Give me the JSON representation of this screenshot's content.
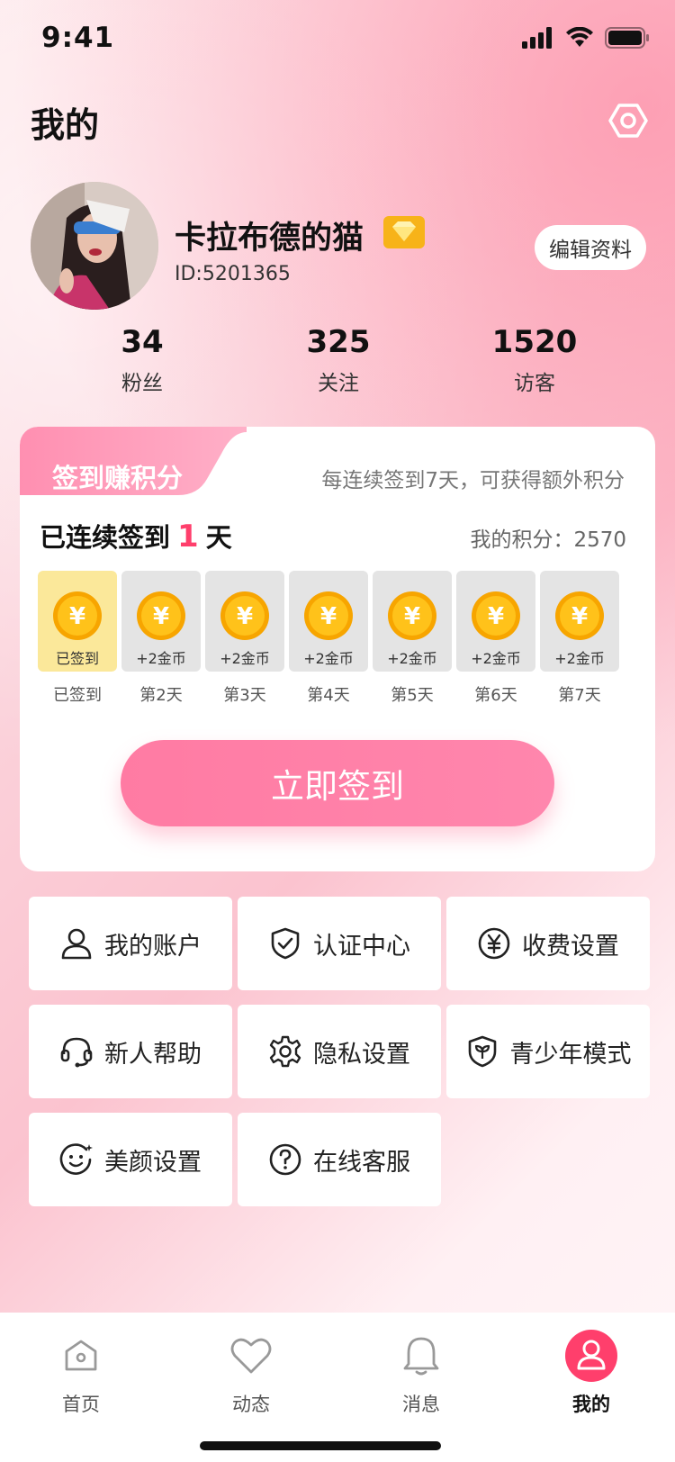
{
  "status_bar": {
    "time": "9:41"
  },
  "header": {
    "title": "我的"
  },
  "profile": {
    "username": "卡拉布德的猫",
    "user_id": "ID:5201365",
    "edit_label": "编辑资料",
    "stats": [
      {
        "value": "34",
        "label": "粉丝"
      },
      {
        "value": "325",
        "label": "关注"
      },
      {
        "value": "1520",
        "label": "访客"
      }
    ]
  },
  "checkin": {
    "tab_title": "签到赚积分",
    "hint": "每连续签到7天，可获得额外积分",
    "streak_prefix": "已连续签到",
    "streak_days": "1",
    "streak_suffix": "天",
    "points_text": "我的积分：2570",
    "days": [
      {
        "reward": "已签到",
        "label": "已签到",
        "done": true
      },
      {
        "reward": "+2金币",
        "label": "第2天",
        "done": false
      },
      {
        "reward": "+2金币",
        "label": "第3天",
        "done": false
      },
      {
        "reward": "+2金币",
        "label": "第4天",
        "done": false
      },
      {
        "reward": "+2金币",
        "label": "第5天",
        "done": false
      },
      {
        "reward": "+2金币",
        "label": "第6天",
        "done": false
      },
      {
        "reward": "+2金币",
        "label": "第7天",
        "done": false
      }
    ],
    "button_label": "立即签到"
  },
  "menu": [
    {
      "label": "我的账户",
      "icon": "user-icon"
    },
    {
      "label": "认证中心",
      "icon": "shield-check-icon"
    },
    {
      "label": "收费设置",
      "icon": "yen-icon"
    },
    {
      "label": "新人帮助",
      "icon": "headset-icon"
    },
    {
      "label": "隐私设置",
      "icon": "gear-icon"
    },
    {
      "label": "青少年模式",
      "icon": "shield-leaf-icon"
    },
    {
      "label": "美颜设置",
      "icon": "smile-sparkle-icon"
    },
    {
      "label": "在线客服",
      "icon": "question-icon"
    }
  ],
  "tabbar": {
    "items": [
      {
        "label": "首页",
        "icon": "home-icon"
      },
      {
        "label": "动态",
        "icon": "heart-icon"
      },
      {
        "label": "消息",
        "icon": "bell-icon"
      },
      {
        "label": "我的",
        "icon": "user-icon"
      }
    ],
    "active_index": 3
  },
  "colors": {
    "accent": "#ff3f6c",
    "button": "#ff7ba3",
    "gold": "#f7b319"
  }
}
